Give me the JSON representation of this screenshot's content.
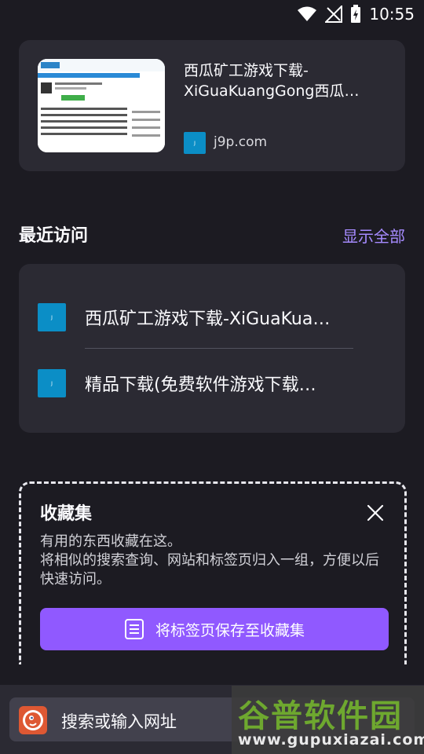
{
  "status": {
    "time": "10:55",
    "icons": [
      "wifi-icon",
      "signal-off-icon",
      "battery-charging-icon"
    ]
  },
  "top_site": {
    "title": "西瓜矿工游戏下载-XiGuaKuangGong西瓜…",
    "domain": "j9p.com",
    "thumbnail_icon": "webpage-thumbnail"
  },
  "recent": {
    "heading": "最近访问",
    "show_all": "显示全部",
    "items": [
      {
        "title": "西瓜矿工游戏下载-XiGuaKua…"
      },
      {
        "title": "精品下载(免费软件游戏下载…"
      }
    ]
  },
  "collections": {
    "title": "收藏集",
    "description": "有用的东西收藏在这。\n将相似的搜索查询、网站和标签页归入一组，方便以后快速访问。",
    "button": "将标签页保存至收藏集"
  },
  "toolbar": {
    "search_placeholder": "搜索或输入网址"
  },
  "watermark": {
    "brand": "谷普软件园",
    "url": "www.gupuxiazai.com"
  },
  "colors": {
    "background": "#1c1b22",
    "card": "#2b2a33",
    "accent": "#9059ff",
    "link": "#a68bff"
  }
}
